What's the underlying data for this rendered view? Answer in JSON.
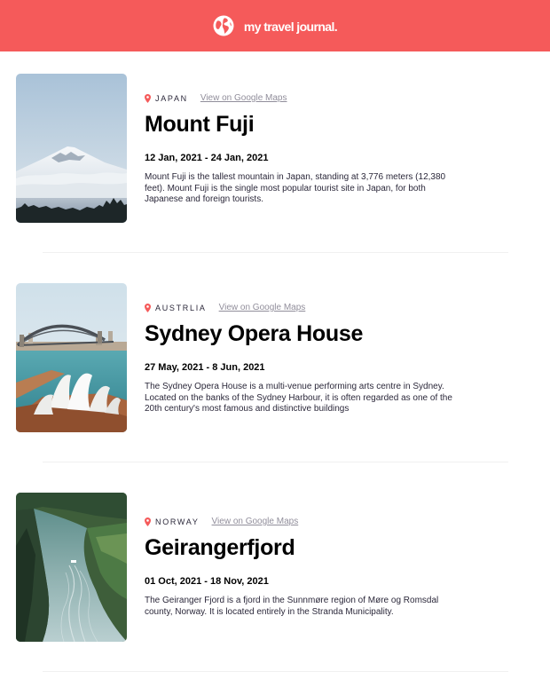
{
  "header": {
    "title": "my travel journal.",
    "icon": "globe-icon",
    "background": "#F55A5A"
  },
  "entries": [
    {
      "country": "JAPAN",
      "maps_link": "View on Google Maps",
      "place": "Mount Fuji",
      "dates": "12 Jan, 2021 - 24 Jan, 2021",
      "description": "Mount Fuji is the tallest mountain in Japan, standing at 3,776 meters (12,380 feet). Mount Fuji is the single most popular tourist site in Japan, for both Japanese and foreign tourists."
    },
    {
      "country": "AUSTRLIA",
      "maps_link": "View on Google Maps",
      "place": "Sydney Opera House",
      "dates": "27 May, 2021 - 8 Jun, 2021",
      "description": "The Sydney Opera House is a multi-venue performing arts centre in Sydney. Located on the banks of the Sydney Harbour, it is often regarded as one of the 20th century's most famous and distinctive buildings"
    },
    {
      "country": "NORWAY",
      "maps_link": "View on Google Maps",
      "place": "Geirangerfjord",
      "dates": "01 Oct, 2021 - 18 Nov, 2021",
      "description": "The Geiranger Fjord is a fjord in the Sunnmøre region of Møre og Romsdal county, Norway. It is located entirely in the Stranda Municipality."
    }
  ],
  "colors": {
    "accent": "#F55A5A",
    "link": "#918E9B",
    "text": "#2B283A"
  }
}
